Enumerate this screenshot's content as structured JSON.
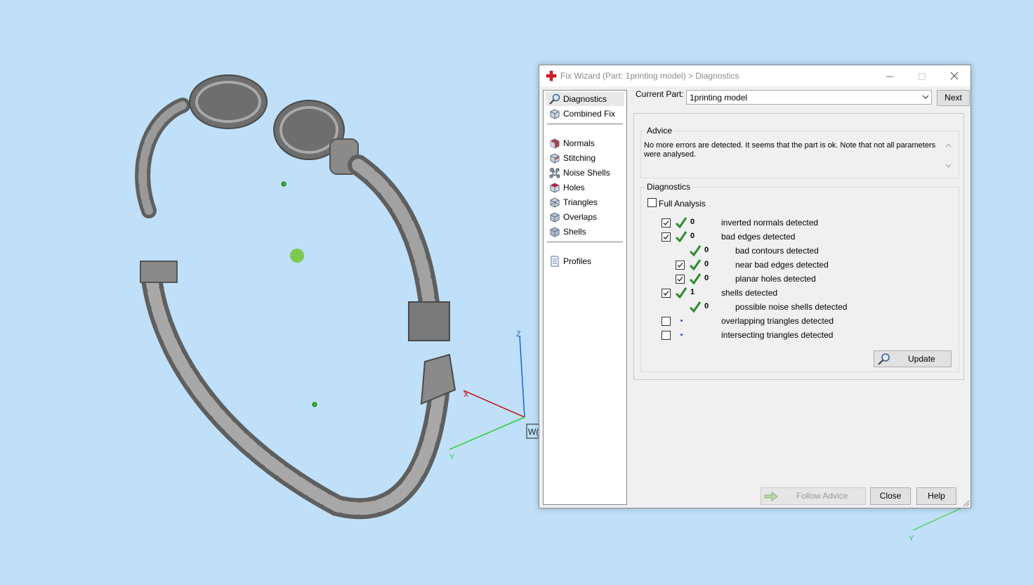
{
  "dialog": {
    "title": "Fix Wizard (Part: 1printing model) > Diagnostics",
    "minimize_icon": "minimize-icon",
    "maximize_icon": "maximize-icon",
    "close_icon": "close-icon"
  },
  "nav": {
    "items": [
      {
        "label": "Diagnostics",
        "icon": "magnifier-icon",
        "selected": true
      },
      {
        "label": "Combined Fix",
        "icon": "cube-icon"
      },
      {
        "label": "Normals",
        "icon": "normals-cube-icon"
      },
      {
        "label": "Stitching",
        "icon": "stitching-cube-icon"
      },
      {
        "label": "Noise Shells",
        "icon": "noise-shells-icon"
      },
      {
        "label": "Holes",
        "icon": "holes-cube-icon"
      },
      {
        "label": "Triangles",
        "icon": "triangles-cube-icon"
      },
      {
        "label": "Overlaps",
        "icon": "overlaps-cube-icon"
      },
      {
        "label": "Shells",
        "icon": "shells-cube-icon"
      },
      {
        "label": "Profiles",
        "icon": "document-icon"
      }
    ]
  },
  "current_part": {
    "label": "Current Part:",
    "value": "1printing model",
    "next_label": "Next"
  },
  "advice": {
    "title": "Advice",
    "text": "No more errors are detected. It seems that the part is ok. Note that not all parameters were analysed."
  },
  "diagnostics": {
    "title": "Diagnostics",
    "full_analysis_label": "Full Analysis",
    "full_analysis_checked": false,
    "rows": [
      {
        "count": "0",
        "label": "inverted normals detected",
        "checked": true,
        "status": "ok"
      },
      {
        "count": "0",
        "label": "bad edges detected",
        "checked": true,
        "status": "ok"
      },
      {
        "count": "0",
        "label": "bad contours detected",
        "status": "ok"
      },
      {
        "count": "0",
        "label": "near bad edges detected",
        "checked": true,
        "status": "ok"
      },
      {
        "count": "0",
        "label": "planar holes detected",
        "checked": true,
        "status": "ok"
      },
      {
        "count": "1",
        "label": "shells detected",
        "checked": true,
        "status": "ok"
      },
      {
        "count": "0",
        "label": "possible noise shells detected",
        "status": "ok"
      },
      {
        "count": "",
        "label": "overlapping triangles detected",
        "checked": false,
        "status": "not-analysed"
      },
      {
        "count": "",
        "label": "intersecting triangles detected",
        "checked": false,
        "status": "not-analysed"
      }
    ],
    "update_label": "Update"
  },
  "buttons": {
    "follow_advice": "Follow Advice",
    "close": "Close",
    "help": "Help"
  },
  "viewport": {
    "background": "#bfe0f8",
    "axis_labels": {
      "x": "X",
      "y": "Y",
      "z": "Z",
      "y2": "Y",
      "tag": "W("
    }
  },
  "colors": {
    "check_green": "#2e8b2e",
    "axis_x": "#c00000",
    "axis_y": "#33cc33",
    "axis_z": "#2060d0",
    "title_icon_red": "#d42020"
  }
}
